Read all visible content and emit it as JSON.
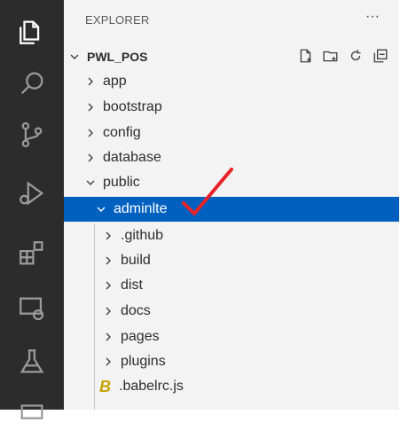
{
  "activity_bar": {
    "icons": [
      "explorer-icon",
      "search-icon",
      "source-control-icon",
      "run-debug-icon",
      "extensions-icon",
      "remote-explorer-icon",
      "testing-icon"
    ]
  },
  "explorer": {
    "title": "EXPLORER",
    "more": "···",
    "root": {
      "label": "PWL_POS",
      "actions": [
        "new-file-icon",
        "new-folder-icon",
        "refresh-icon",
        "collapse-all-icon"
      ]
    },
    "items": [
      {
        "label": "app",
        "type": "folder",
        "expanded": false
      },
      {
        "label": "bootstrap",
        "type": "folder",
        "expanded": false
      },
      {
        "label": "config",
        "type": "folder",
        "expanded": false
      },
      {
        "label": "database",
        "type": "folder",
        "expanded": false
      },
      {
        "label": "public",
        "type": "folder",
        "expanded": true
      },
      {
        "label": "adminlte",
        "type": "folder",
        "expanded": true,
        "selected": true
      },
      {
        "label": ".github",
        "type": "folder",
        "expanded": false
      },
      {
        "label": "build",
        "type": "folder",
        "expanded": false
      },
      {
        "label": "dist",
        "type": "folder",
        "expanded": false
      },
      {
        "label": "docs",
        "type": "folder",
        "expanded": false
      },
      {
        "label": "pages",
        "type": "folder",
        "expanded": false
      },
      {
        "label": "plugins",
        "type": "folder",
        "expanded": false
      },
      {
        "label": ".babelrc.js",
        "type": "file",
        "icon": "babel-icon"
      }
    ]
  },
  "annotation": {
    "icon": "red-checkmark-icon",
    "color": "#e8232a"
  },
  "colors": {
    "selection": "#0060c0",
    "activity_bar": "#2c2c2c",
    "sidebar": "#f3f3f3"
  }
}
